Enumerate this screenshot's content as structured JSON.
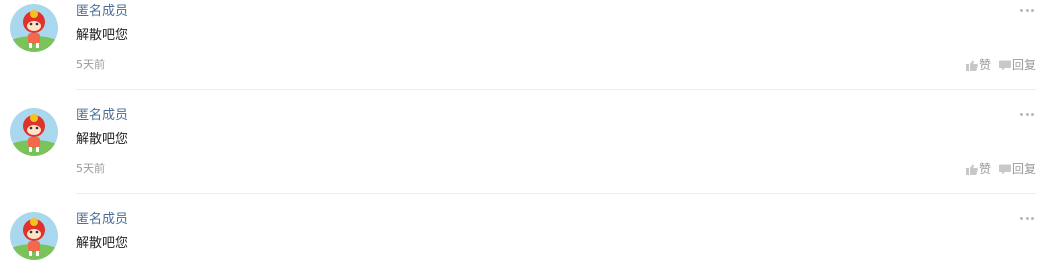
{
  "comments": [
    {
      "author": "匿名成员",
      "content": "解散吧您",
      "time": "5天前",
      "like_label": "赞",
      "reply_label": "回复"
    },
    {
      "author": "匿名成员",
      "content": "解散吧您",
      "time": "5天前",
      "like_label": "赞",
      "reply_label": "回复"
    },
    {
      "author": "匿名成员",
      "content": "解散吧您"
    }
  ],
  "icons": {
    "more": "more-dots-icon",
    "like": "thumbs-up-icon",
    "reply": "speech-bubble-icon",
    "avatar": "cartoon-mascot-avatar"
  },
  "colors": {
    "author": "#4a6e9a",
    "content": "#222222",
    "meta": "#999999",
    "divider": "#ececec"
  }
}
